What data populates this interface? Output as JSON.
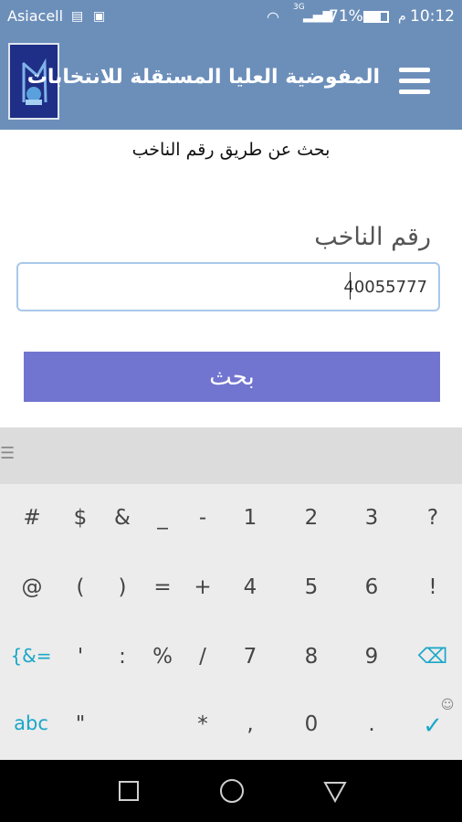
{
  "status_bar": {
    "carrier": "Asiacell",
    "network": "3G",
    "battery": "71%",
    "period": "م",
    "time": "10:12"
  },
  "app_bar": {
    "title": "المفوضية العليا المستقلة للانتخابات"
  },
  "main": {
    "subtitle": "بحث عن طريق رقم الناخب",
    "voter_label": "رقم الناخب",
    "voter_value": "40055777",
    "search_label": "بحث"
  },
  "keyboard": {
    "rows": [
      [
        "#",
        "$",
        "&",
        "_",
        "-",
        "1",
        "2",
        "3",
        "?"
      ],
      [
        "@",
        "(",
        ")",
        "=",
        "+",
        "4",
        "5",
        "6",
        "!"
      ],
      [
        "{&=",
        "'",
        ":",
        "%",
        "/",
        "7",
        "8",
        "9",
        "⌫"
      ],
      [
        "abc",
        "\"",
        "",
        "*",
        ",",
        "0",
        ".",
        "✓"
      ]
    ]
  },
  "colors": {
    "header": "#6c8fba",
    "button": "#7275cf",
    "accent": "#1aa7c8"
  }
}
